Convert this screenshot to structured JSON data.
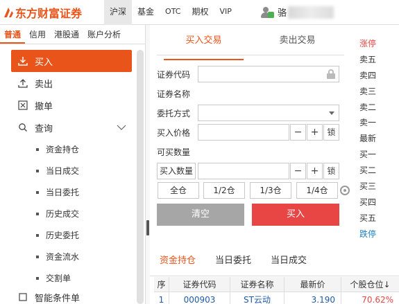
{
  "app": {
    "logo_text": "东方财富证券"
  },
  "nav": {
    "items": [
      "沪深",
      "基金",
      "OTC",
      "期权",
      "VIP"
    ],
    "active": "沪深"
  },
  "user": {
    "name_visible": "骆"
  },
  "left_tabs": [
    "普通",
    "信用",
    "港股通",
    "账户分析"
  ],
  "menu": {
    "buy": "买入",
    "sell": "卖出",
    "cancel": "撤单",
    "query": "查询",
    "sub_items": [
      "资金持仓",
      "当日成交",
      "当日委托",
      "历史成交",
      "历史委托",
      "资金流水",
      "交割单"
    ],
    "smart": "智能条件单"
  },
  "trade": {
    "tab_buy": "买入交易",
    "tab_sell": "卖出交易",
    "label_code": "证券代码",
    "label_name": "证券名称",
    "label_method": "委托方式",
    "label_price": "买入价格",
    "label_available": "可买数量",
    "label_qty": "买入数量",
    "minus": "−",
    "plus": "+",
    "lock": "锁",
    "ratios": [
      "全仓",
      "1/2仓",
      "1/3仓",
      "1/4仓"
    ],
    "btn_clear": "清空",
    "btn_buy": "买入"
  },
  "quotes": [
    "涨停",
    "卖五",
    "卖四",
    "卖三",
    "卖二",
    "卖一",
    "最新",
    "买一",
    "买二",
    "买三",
    "买四",
    "买五",
    "跌停"
  ],
  "bottom_tabs": [
    "资金持仓",
    "当日委托",
    "当日成交"
  ],
  "table": {
    "headers": [
      "序",
      "证券代码",
      "证券名称",
      "最新价",
      "个股仓位↓"
    ],
    "rows": [
      [
        "1",
        "000903",
        "ST云动",
        "3.190",
        "70.62%"
      ]
    ]
  },
  "colors": {
    "accent": "#e8541a",
    "buy_red": "#e84545",
    "limit_down_blue": "#1e7fc0"
  }
}
